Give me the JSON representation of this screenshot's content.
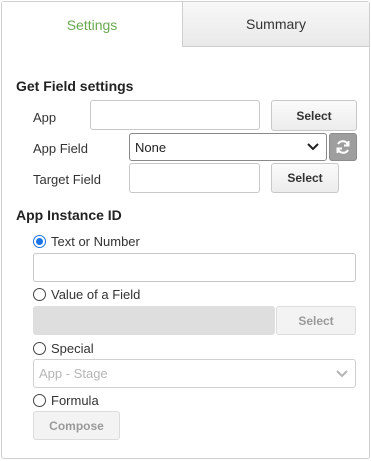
{
  "tabs": {
    "settings": "Settings",
    "summary": "Summary"
  },
  "get_field": {
    "title": "Get Field settings",
    "app_label": "App",
    "app_value": "",
    "app_select": "Select",
    "app_field_label": "App Field",
    "app_field_value": "None",
    "target_field_label": "Target Field",
    "target_field_value": "",
    "target_select": "Select"
  },
  "instance": {
    "title": "App Instance ID",
    "text_or_number": "Text or Number",
    "text_value": "",
    "value_of_field": "Value of a Field",
    "field_select": "Select",
    "special": "Special",
    "special_placeholder": "App - Stage",
    "formula": "Formula",
    "compose": "Compose"
  },
  "colors": {
    "active_tab": "#6aa84f",
    "radio_accent": "#1a73e8"
  }
}
